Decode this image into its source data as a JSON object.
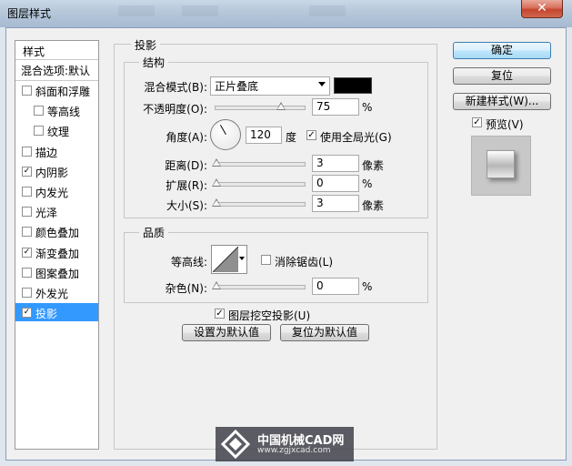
{
  "window": {
    "title": "图层样式",
    "close_glyph": "✕"
  },
  "list": {
    "header": "样式",
    "blend_options": "混合选项:默认",
    "items": [
      {
        "label": "斜面和浮雕",
        "checked": false,
        "indent": false
      },
      {
        "label": "等高线",
        "checked": false,
        "indent": true
      },
      {
        "label": "纹理",
        "checked": false,
        "indent": true
      },
      {
        "label": "描边",
        "checked": false,
        "indent": false
      },
      {
        "label": "内阴影",
        "checked": true,
        "indent": false
      },
      {
        "label": "内发光",
        "checked": false,
        "indent": false
      },
      {
        "label": "光泽",
        "checked": false,
        "indent": false
      },
      {
        "label": "颜色叠加",
        "checked": false,
        "indent": false
      },
      {
        "label": "渐变叠加",
        "checked": true,
        "indent": false
      },
      {
        "label": "图案叠加",
        "checked": false,
        "indent": false
      },
      {
        "label": "外发光",
        "checked": false,
        "indent": false
      },
      {
        "label": "投影",
        "checked": true,
        "indent": false,
        "selected": true
      }
    ]
  },
  "shadow": {
    "section_title": "投影",
    "structure": {
      "title": "结构",
      "blend_mode_label": "混合模式(B):",
      "blend_mode_value": "正片叠底",
      "blend_color": "#000000",
      "opacity_label": "不透明度(O):",
      "opacity_value": "75",
      "opacity_unit": "%",
      "angle_label": "角度(A):",
      "angle_value": "120",
      "angle_unit": "度",
      "global_light_label": "使用全局光(G)",
      "global_light_checked": true,
      "distance_label": "距离(D):",
      "distance_value": "3",
      "distance_unit": "像素",
      "spread_label": "扩展(R):",
      "spread_value": "0",
      "spread_unit": "%",
      "size_label": "大小(S):",
      "size_value": "3",
      "size_unit": "像素"
    },
    "quality": {
      "title": "品质",
      "contour_label": "等高线:",
      "antialias_label": "消除锯齿(L)",
      "antialias_checked": false,
      "noise_label": "杂色(N):",
      "noise_value": "0",
      "noise_unit": "%"
    },
    "knockout_label": "图层挖空投影(U)",
    "knockout_checked": true,
    "make_default": "设置为默认值",
    "reset_default": "复位为默认值"
  },
  "buttons": {
    "ok": "确定",
    "reset": "复位",
    "new_style": "新建样式(W)...",
    "preview_label": "预览(V)",
    "preview_checked": true
  },
  "watermark": {
    "line1": "中国机械CAD网",
    "line2": "www.zgjxcad.com"
  },
  "check_glyph": "✓"
}
